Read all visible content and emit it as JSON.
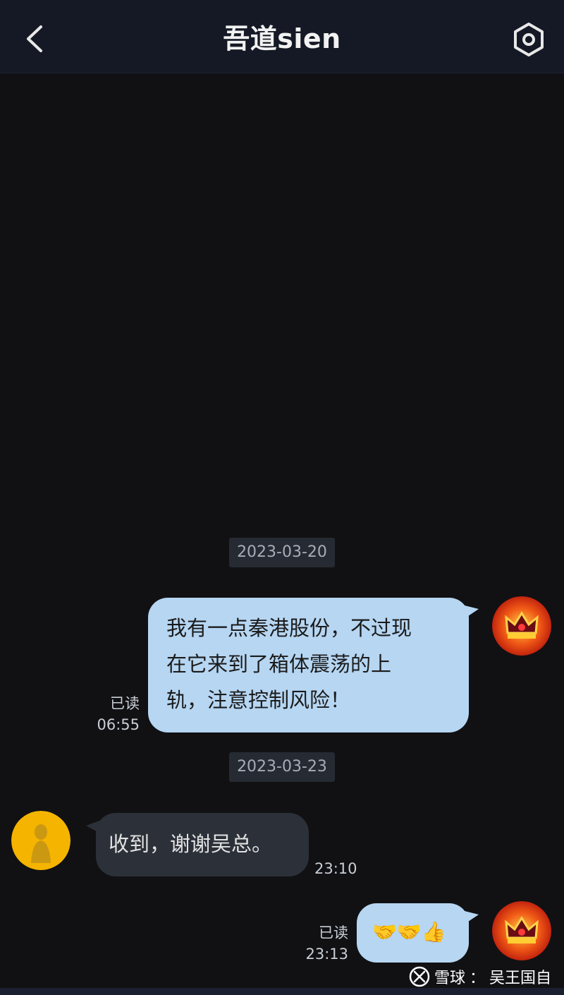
{
  "header": {
    "title": "吾道sien",
    "back_icon": "back-arrow-icon",
    "settings_icon": "settings-gear-icon"
  },
  "messages": [
    {
      "type": "date",
      "text": "2023-03-20"
    },
    {
      "type": "outgoing",
      "text_lines": [
        "我有一点秦港股份，不过现",
        "在它来到了箱体震荡的上",
        "轨，注意控制风险！"
      ],
      "status": "已读",
      "time": "06:55"
    },
    {
      "type": "date",
      "text": "2023-03-23"
    },
    {
      "type": "incoming",
      "text": "收到，谢谢吴总。",
      "time": "23:10"
    },
    {
      "type": "outgoing",
      "emoji": "🤝🤝👍",
      "status": "已读",
      "time": "23:13"
    }
  ],
  "watermark": {
    "brand": "雪球",
    "separator": "：",
    "author": "吴王国自"
  },
  "colors": {
    "background": "#111113",
    "header": "#141925",
    "outgoing_bubble": "#b6d6f2",
    "incoming_bubble": "#2c3039"
  }
}
